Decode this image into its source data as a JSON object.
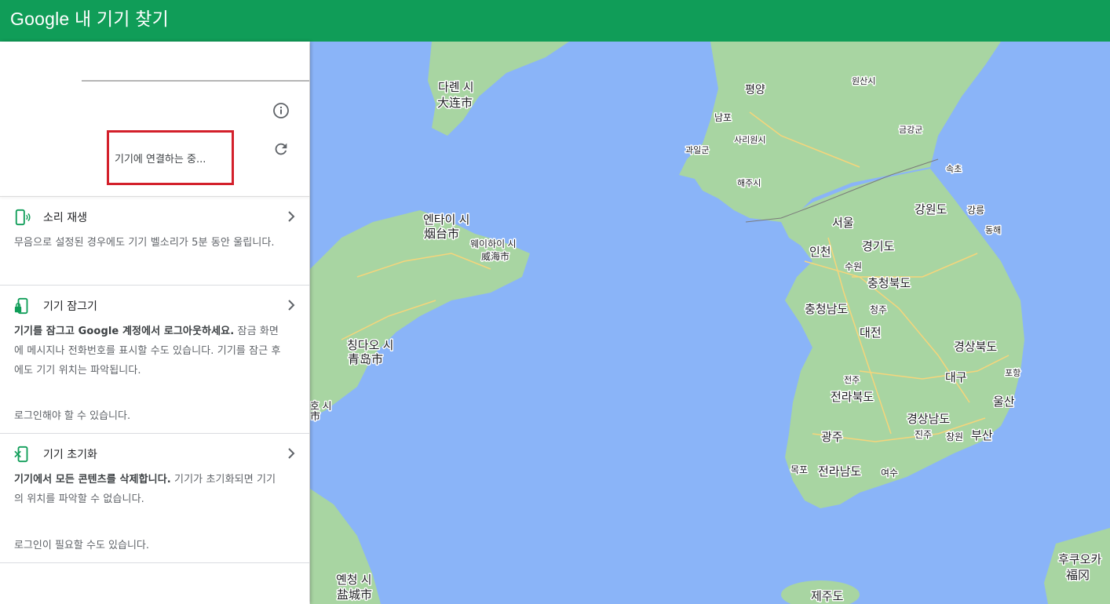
{
  "app": {
    "title": "Google 내 기기 찾기"
  },
  "device": {
    "status": "기기에 연결하는 중..."
  },
  "icons": {
    "info": "info-icon",
    "refresh": "refresh-icon",
    "chevron": "chevron-right-icon"
  },
  "actions": [
    {
      "title": "소리 재생",
      "desc_bold": "",
      "desc": "무음으로 설정된 경우에도 기기 벨소리가 5분 동안 울립니다.",
      "note": ""
    },
    {
      "title": "기기 잠그기",
      "desc_bold": "기기를 잠그고 Google 계정에서 로그아웃하세요.",
      "desc": " 잠금 화면에 메시지나 전화번호를 표시할 수도 있습니다. 기기를 잠근 후에도 기기 위치는 파악됩니다.",
      "note": "로그인해야 할 수 있습니다."
    },
    {
      "title": "기기 초기화",
      "desc_bold": "기기에서 모든 콘텐츠를 삭제합니다.",
      "desc": " 기기가 초기화되면 기기의 위치를 파악할 수 없습니다.",
      "note": "로그인이 필요할 수도 있습니다."
    }
  ],
  "map": {
    "labels": [
      "다롄 시",
      "大连市",
      "평양",
      "원산시",
      "남포",
      "사리원시",
      "금강군",
      "과일군",
      "속초",
      "해주시",
      "엔타이 시",
      "烟台市",
      "웨이하이 시",
      "威海市",
      "서울",
      "강원도",
      "강릉",
      "동해",
      "인천",
      "경기도",
      "수원",
      "충청북도",
      "충청남도",
      "청주",
      "대전",
      "경상북도",
      "칭다오 시",
      "青岛市",
      "대구",
      "포항",
      "전주",
      "전라북도",
      "울산",
      "경상남도",
      "광주",
      "진주",
      "창원",
      "부산",
      "목포",
      "전라남도",
      "여수",
      "후쿠오카",
      "福冈",
      "옌청 시",
      "盐城市",
      "제주도",
      "호 시",
      "市"
    ]
  },
  "colors": {
    "header": "#109d58",
    "water": "#8ab4f8",
    "land": "#a8d5a2",
    "highlight": "#d3202b"
  }
}
